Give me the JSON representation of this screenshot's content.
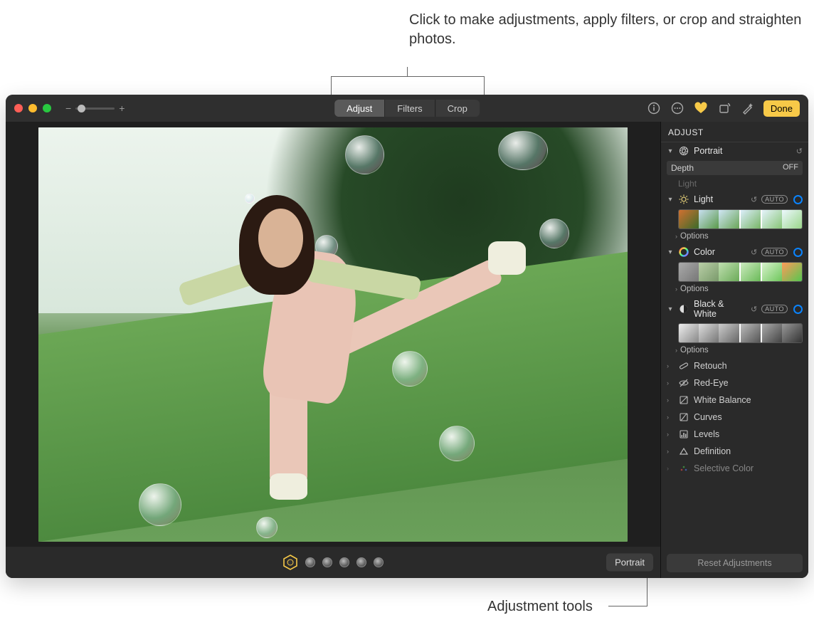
{
  "callouts": {
    "top": "Click to make adjustments, apply filters, or crop and straighten photos.",
    "bottom": "Adjustment tools"
  },
  "toolbar": {
    "zoom_minus": "−",
    "zoom_plus": "+",
    "segments": {
      "adjust": "Adjust",
      "filters": "Filters",
      "crop": "Crop"
    },
    "done": "Done"
  },
  "bottom": {
    "portrait_button": "Portrait"
  },
  "sidebar": {
    "header": "ADJUST",
    "portrait": {
      "label": "Portrait"
    },
    "depth": {
      "label": "Depth",
      "value": "OFF"
    },
    "light_sub": "Light",
    "light": {
      "label": "Light",
      "auto": "AUTO"
    },
    "color": {
      "label": "Color",
      "auto": "AUTO"
    },
    "bw": {
      "label": "Black & White",
      "auto": "AUTO"
    },
    "options": "Options",
    "rows": {
      "retouch": "Retouch",
      "red_eye": "Red-Eye",
      "white_balance": "White Balance",
      "curves": "Curves",
      "levels": "Levels",
      "definition": "Definition",
      "selective_color": "Selective Color"
    },
    "reset": "Reset Adjustments"
  },
  "glyphs": {
    "undo": "↺",
    "chevron_down": "▾",
    "chevron_right": "›"
  }
}
